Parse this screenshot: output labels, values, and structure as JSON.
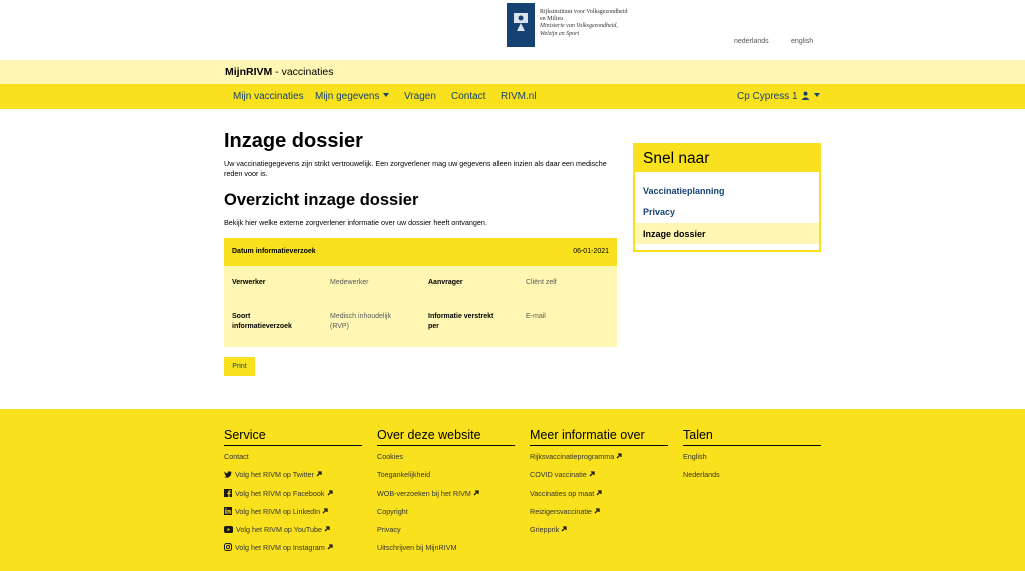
{
  "header": {
    "logo_lines": [
      "Rijksinstituut voor Volksgezondheid",
      "en Milieu",
      "Ministerie van Volksgezondheid,",
      "Welzijn en Sport"
    ],
    "lang_nl": "nederlands",
    "lang_en": "english"
  },
  "app": {
    "brand": "MijnRIVM",
    "suffix": " - vaccinaties"
  },
  "nav": {
    "items": [
      "Mijn vaccinaties",
      "Mijn gegevens",
      "Vragen",
      "Contact",
      "RIVM.nl"
    ],
    "user": "Cp Cypress 1"
  },
  "main": {
    "title": "Inzage dossier",
    "intro": "Uw vaccinatiegegevens zijn strikt vertrouwelijk. Een zorgverlener mag uw gegevens alleen inzien als daar een medische reden voor is.",
    "subtitle": "Overzicht inzage dossier",
    "subintro": "Bekijk hier welke externe zorgverlener informatie over uw dossier heeft ontvangen.",
    "record": {
      "head_label": "Datum informatieverzoek",
      "date": "06-01-2021",
      "verwerker_label": "Verwerker",
      "verwerker_value": "Medewerker",
      "aanvrager_label": "Aanvrager",
      "aanvrager_value": "Cliënt zelf",
      "soort_label_1": "Soort",
      "soort_label_2": "informatieverzoek",
      "soort_value_1": "Medisch inhoudelijk",
      "soort_value_2": "(RVP)",
      "verstrekt_label_1": "Informatie verstrekt",
      "verstrekt_label_2": "per",
      "verstrekt_value": "E-mail"
    },
    "print_label": "Print"
  },
  "sidebar": {
    "title": "Snel naar",
    "links": [
      "Vaccinatieplanning",
      "Privacy"
    ],
    "active": "Inzage dossier"
  },
  "footer": {
    "service": {
      "title": "Service",
      "links": [
        "Contact",
        "Volg het RIVM op Twitter",
        "Volg het RIVM op Facebook",
        "Volg het RIVM op LinkedIn",
        "Volg het RIVM op YouTube",
        "Volg het RIVM op Instagram"
      ]
    },
    "website": {
      "title": "Over deze website",
      "links": [
        "Cookies",
        "Toegankelijkheid",
        "WOB-verzoeken bij het RIVM",
        "Copyright",
        "Privacy",
        "Uitschrijven bij MijnRIVM"
      ]
    },
    "meer": {
      "title": "Meer informatie over",
      "links": [
        "Rijksvaccinatieprogramma",
        "COVID vaccinatie",
        "Vaccinaties op maat",
        "Reizigersvaccinatie",
        "Griepprik"
      ]
    },
    "talen": {
      "title": "Talen",
      "links": [
        "English",
        "Nederlands"
      ]
    }
  },
  "colors": {
    "yellow": "#f9e11e",
    "light_yellow": "#fff7b3",
    "link_blue": "#154273"
  }
}
